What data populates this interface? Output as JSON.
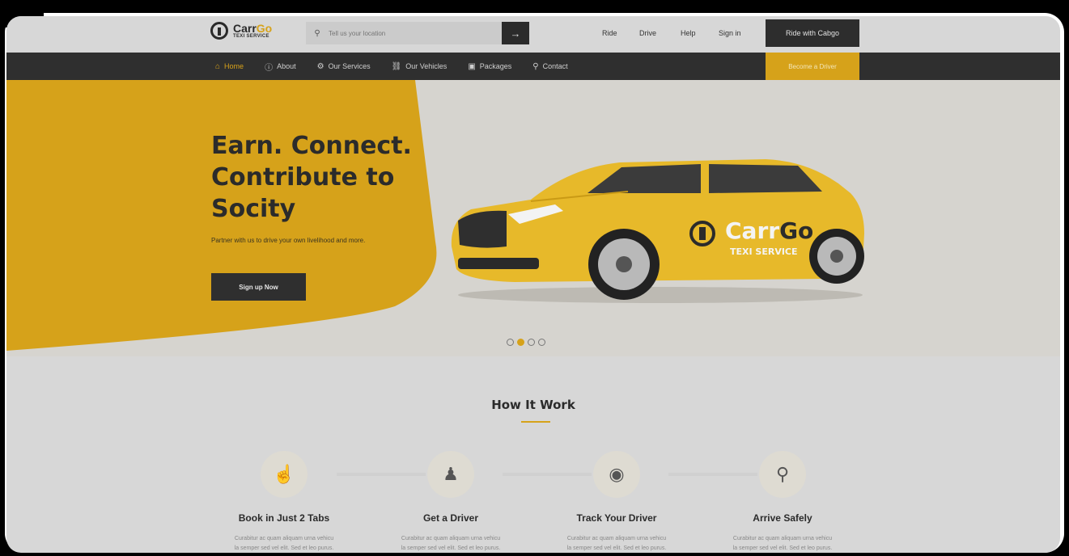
{
  "brand": {
    "name_part1": "Carr",
    "name_part2": "Go",
    "tagline": "TEXI SERVICE"
  },
  "search": {
    "placeholder": "Tell us your location",
    "pin_icon": "map-pin-icon",
    "submit_icon": "arrow-right-icon"
  },
  "top_links": [
    "Ride",
    "Drive",
    "Help",
    "Sign in"
  ],
  "ride_button": "Ride with Cabgo",
  "nav": {
    "items": [
      {
        "label": "Home",
        "icon": "home-icon",
        "active": true
      },
      {
        "label": "About",
        "icon": "info-icon"
      },
      {
        "label": "Our Services",
        "icon": "services-icon"
      },
      {
        "label": "Our Vehicles",
        "icon": "car-icon"
      },
      {
        "label": "Packages",
        "icon": "package-icon"
      },
      {
        "label": "Contact",
        "icon": "location-icon"
      }
    ],
    "cta": "Become a Driver"
  },
  "hero": {
    "title_line1": "Earn. Connect.",
    "title_line2": "Contribute to",
    "title_line3": "Socity",
    "subtitle": "Partner with us to drive your own livelihood and more.",
    "button": "Sign up Now",
    "car_logo_text1": "Carr",
    "car_logo_text2": "Go",
    "car_logo_sub": "TEXI SERVICE",
    "slides": 4,
    "active_slide": 2
  },
  "how": {
    "title": "How It Work",
    "steps": [
      {
        "title": "Book in Just 2 Tabs",
        "icon": "tap-hand-icon",
        "text1": "Curabitur ac quam aliquam urna vehicu",
        "text2": "la semper sed vel elit. Sed et leo purus."
      },
      {
        "title": "Get a Driver",
        "icon": "driver-icon",
        "text1": "Curabitur ac quam aliquam urna vehicu",
        "text2": "la semper sed vel elit. Sed et leo purus."
      },
      {
        "title": "Track Your Driver",
        "icon": "track-car-icon",
        "text1": "Curabitur ac quam aliquam urna vehicu",
        "text2": "la semper sed vel elit. Sed et leo purus."
      },
      {
        "title": "Arrive Safely",
        "icon": "map-marker-icon",
        "text1": "Curabitur ac quam aliquam urna vehicu",
        "text2": "la semper sed vel elit. Sed et leo purus."
      }
    ]
  },
  "colors": {
    "accent": "#d6a21a",
    "dark": "#2f2f2f",
    "background": "#d7d7d7"
  }
}
